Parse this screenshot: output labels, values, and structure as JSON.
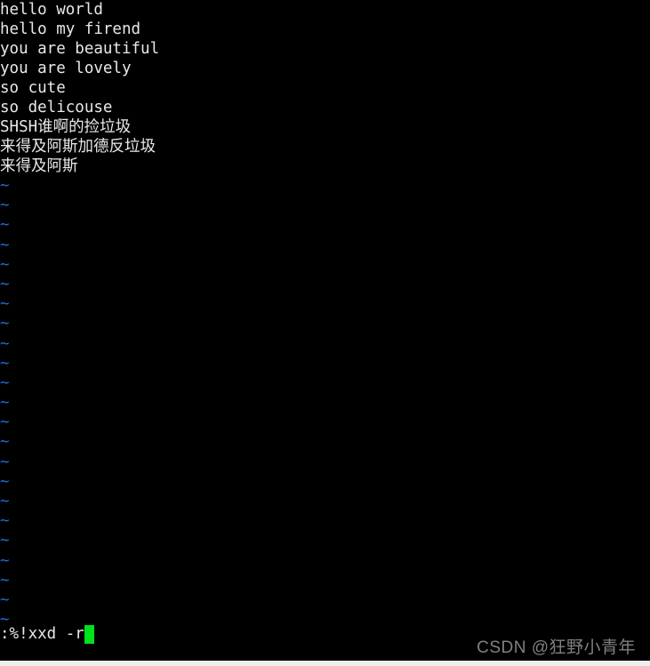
{
  "editor": {
    "name": "vim",
    "background_color": "#000000",
    "text_color": "#e8e8e8",
    "tilde_color": "#1c6fd6",
    "cursor_color": "#00e21c",
    "buffer_lines": [
      "hello world",
      "hello my firend",
      "you are beautiful",
      "you are lovely",
      "so cute",
      "so delicouse",
      "SHSH谁啊的捡垃圾",
      "来得及阿斯加德反垃圾",
      "来得及阿斯"
    ],
    "empty_line_marker": "~",
    "empty_line_count": 23,
    "command_line": {
      "text": ":%!xxd -r",
      "cursor": "block"
    }
  },
  "watermark": {
    "text": "CSDN @狂野小青年",
    "color": "#808080"
  }
}
